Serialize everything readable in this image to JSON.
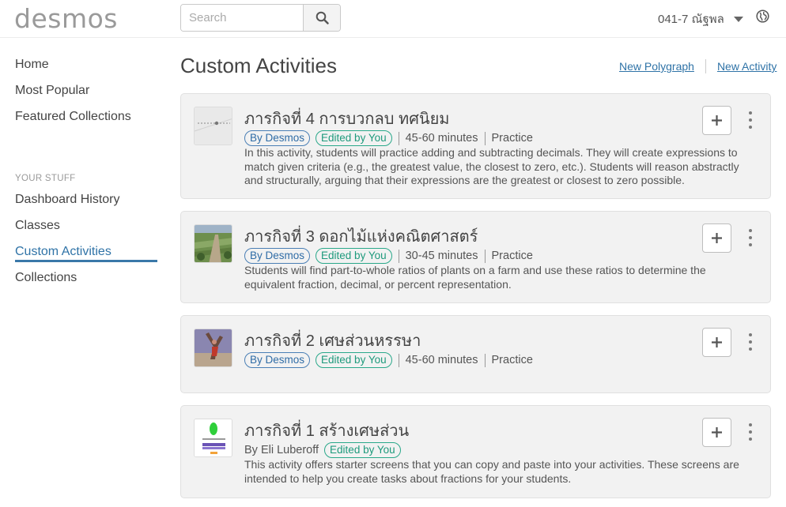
{
  "header": {
    "logo": "desmos",
    "search_placeholder": "Search",
    "user_name": "041-7 ณัฐพล"
  },
  "sidebar": {
    "items": [
      {
        "label": "Home"
      },
      {
        "label": "Most Popular"
      },
      {
        "label": "Featured Collections"
      }
    ],
    "section_label": "YOUR STUFF",
    "stuff_items": [
      {
        "label": "Dashboard History"
      },
      {
        "label": "Classes"
      },
      {
        "label": "Custom Activities",
        "active": true
      },
      {
        "label": "Collections"
      }
    ]
  },
  "main": {
    "title": "Custom Activities",
    "links": {
      "new_polygraph": "New Polygraph",
      "new_activity": "New Activity"
    },
    "activities": [
      {
        "title": "ภารกิจที่ 4 การบวกลบ ทศนิยม",
        "by": "By Desmos",
        "edited": "Edited by You",
        "duration": "45-60 minutes",
        "tag": "Practice",
        "description": "In this activity, students will practice adding and subtracting decimals. They will create expressions to match given criteria (e.g., the greatest value, the closest to zero, etc.). Students will reason abstractly and structurally, arguing that their expressions are the greatest or closest to zero possible."
      },
      {
        "title": "ภารกิจที่ 3 ดอกไม้แห่งคณิตศาสตร์",
        "by": "By Desmos",
        "edited": "Edited by You",
        "duration": "30-45 minutes",
        "tag": "Practice",
        "description": "Students will find part-to-whole ratios of plants on a farm and use these ratios to determine the equivalent fraction, decimal, or percent representation."
      },
      {
        "title": "ภารกิจที่ 2 เศษส่วนหรรษา",
        "by": "By Desmos",
        "edited": "Edited by You",
        "duration": "45-60 minutes",
        "tag": "Practice",
        "description": ""
      },
      {
        "title": "ภารกิจที่ 1 สร้างเศษส่วน",
        "by_author": "By Eli Luberoff",
        "edited": "Edited by You",
        "description": "This activity offers starter screens that you can copy and paste into your activities. These screens are intended to help you create tasks about fractions for your students."
      }
    ]
  },
  "colors": {
    "accent_blue": "#2f73a7",
    "edited_green": "#1e9a7c",
    "card_bg": "#f2f2f2"
  }
}
